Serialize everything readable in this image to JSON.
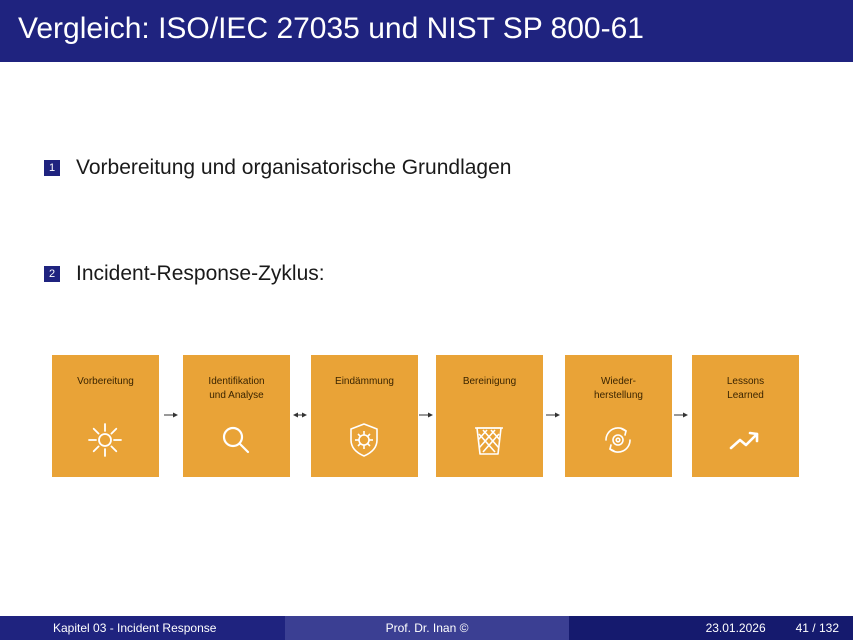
{
  "slide": {
    "title": "Vergleich: ISO/IEC 27035 und NIST SP 800-61"
  },
  "items": [
    {
      "number": "1",
      "text": "Vorbereitung und organisatorische Grundlagen"
    },
    {
      "number": "2",
      "text": "Incident-Response-Zyklus:"
    }
  ],
  "phases": [
    {
      "label": "Vorbereitung",
      "icon": "sun-gear-icon"
    },
    {
      "label": "Identifikation\nund Analyse",
      "icon": "magnifier-icon"
    },
    {
      "label": "Eindämmung",
      "icon": "virus-shield-icon"
    },
    {
      "label": "Bereinigung",
      "icon": "trash-bin-icon"
    },
    {
      "label": "Wieder-\nherstellung",
      "icon": "gear-cycle-icon"
    },
    {
      "label": "Lessons\nLearned",
      "icon": "trend-up-icon"
    }
  ],
  "colors": {
    "accent": "#1f237f",
    "phase_fill": "#e9a337"
  },
  "footer": {
    "chapter": "Kapitel 03 - Incident Response",
    "author": "Prof. Dr. Inan ©",
    "date": "23.01.2026",
    "page": "41 / 132"
  }
}
